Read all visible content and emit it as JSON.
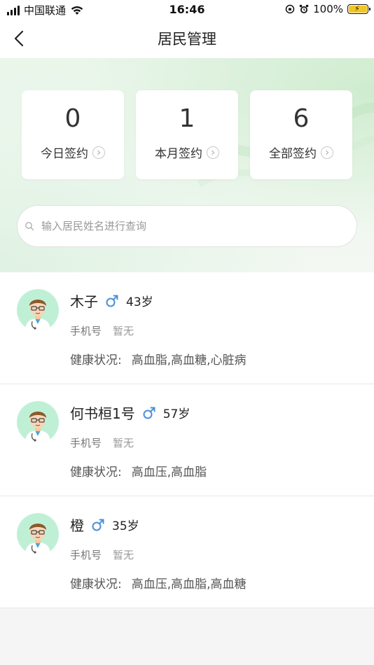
{
  "status_bar": {
    "carrier": "中国联通",
    "time": "16:46",
    "battery": "100%"
  },
  "nav": {
    "title": "居民管理"
  },
  "stats": [
    {
      "value": "0",
      "label": "今日签约"
    },
    {
      "value": "1",
      "label": "本月签约"
    },
    {
      "value": "6",
      "label": "全部签约"
    }
  ],
  "search": {
    "placeholder": "输入居民姓名进行查询",
    "value": ""
  },
  "residents": [
    {
      "name": "木子",
      "gender_icon": "male-icon",
      "age": "43岁",
      "phone_label": "手机号",
      "phone_value": "暂无",
      "health_label": "健康状况:",
      "health_value": "高血脂,高血糖,心脏病"
    },
    {
      "name": "何书桓1号",
      "gender_icon": "male-icon",
      "age": "57岁",
      "phone_label": "手机号",
      "phone_value": "暂无",
      "health_label": "健康状况:",
      "health_value": "高血压,高血脂"
    },
    {
      "name": "橙",
      "gender_icon": "male-icon",
      "age": "35岁",
      "phone_label": "手机号",
      "phone_value": "暂无",
      "health_label": "健康状况:",
      "health_value": "高血压,高血脂,高血糖"
    }
  ],
  "colors": {
    "male": "#4a90d9",
    "avatar_bg": "#bff0d6",
    "hero_tint": "#e9f6ea"
  }
}
